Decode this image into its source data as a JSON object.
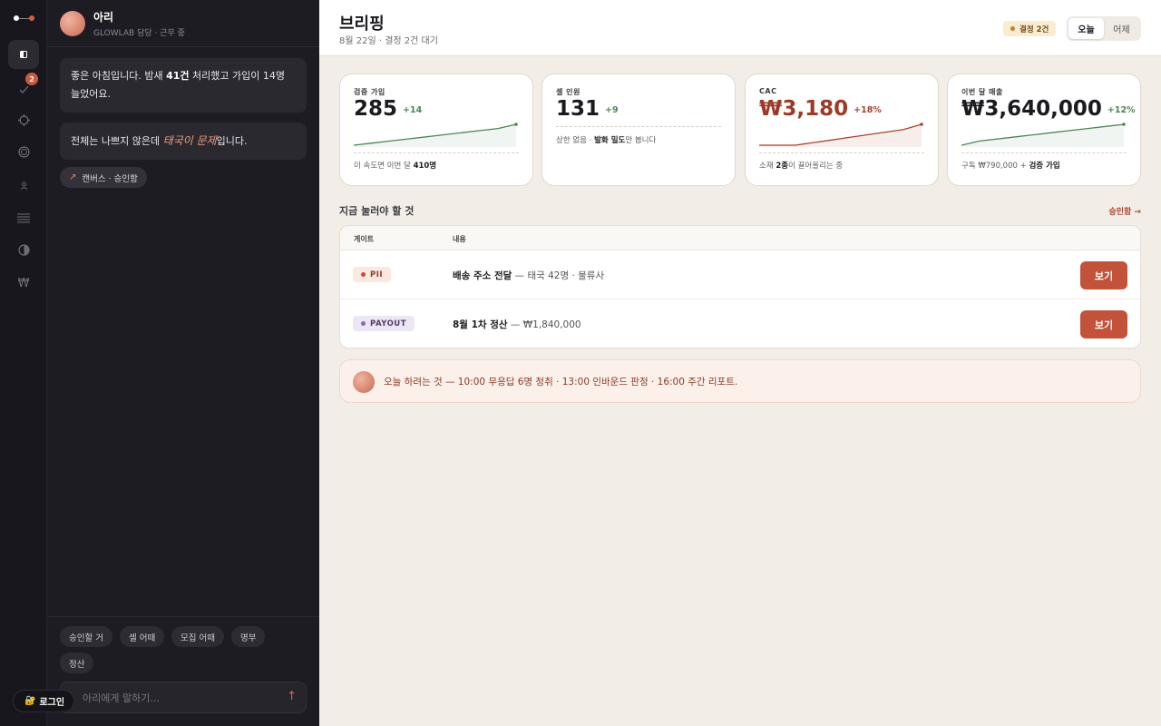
{
  "rail": {
    "notif_badge": "2"
  },
  "chat": {
    "agent_name": "아리",
    "agent_status": "GLOWLAB 담당 · 근무 중",
    "msg1": {
      "p1": "좋은 아침입니다. 밤새 ",
      "bold": "41건",
      "p2": " 처리했고 가입이 14명 늘었어요."
    },
    "msg2": {
      "p1": "전체는 나쁘지 않은데 ",
      "em": "태국이 문제",
      "p2": "입니다."
    },
    "canvas_chip": "캔버스 · 승인함",
    "quick_chips": [
      "승인할 거",
      "셀 어때",
      "모집 어때",
      "명부",
      "정산"
    ],
    "input_placeholder": "아리에게 말하기...",
    "login_label": "로그인"
  },
  "header": {
    "title": "브리핑",
    "subtitle": "8월 22일 · 결정 2건 대기",
    "decision_badge": "결정 2건",
    "tabs": [
      "오늘",
      "어제"
    ],
    "active_tab": "오늘"
  },
  "kpis": [
    {
      "label": "검증 가입",
      "value": "285",
      "delta": "+14",
      "footer_pre": "이 속도면 이번 달 ",
      "footer_bold": "410명",
      "footer_post": "",
      "trend": [
        8,
        9,
        10,
        11,
        12,
        13,
        14,
        15,
        16,
        18
      ]
    },
    {
      "label": "셀 인원",
      "value": "131",
      "delta": "+9",
      "footer_pre": "상한 없음 · ",
      "footer_bold": "발화 밀도",
      "footer_post": "만 봅니다"
    },
    {
      "label": "CAC",
      "value": "₩3,180",
      "delta": "+18%",
      "footer_pre": "소재 ",
      "footer_bold": "2종",
      "footer_post": "이 끌어올리는 중",
      "trend": [
        5,
        5,
        5,
        6,
        7,
        8,
        9,
        10,
        11,
        13
      ]
    },
    {
      "label": "이번 달 매출",
      "value": "₩3,640,000",
      "delta": "+12%",
      "footer_pre": "구독 ₩790,000 + ",
      "footer_bold": "검증 가입",
      "footer_post": "",
      "trend": [
        6,
        8,
        9,
        10,
        11,
        12,
        13,
        14,
        15,
        16
      ]
    }
  ],
  "section": {
    "title": "지금 눌러야 할 것",
    "link": "승인함 →"
  },
  "table": {
    "headers": [
      "게이트",
      "내용"
    ],
    "rows": [
      {
        "gate": "PII",
        "content_bold": "배송 주소 전달",
        "content_rest": " — 태국 42명 · 물류사",
        "action": "보기"
      },
      {
        "gate": "PAYOUT",
        "content_bold": "8월 1차 정산",
        "content_rest": " — ₩1,840,000",
        "action": "보기"
      }
    ]
  },
  "plan": {
    "text": "오늘 하려는 것 — 10:00 무응답 6명 청취 · 13:00 인바운드 판정 · 16:00 주간 리포트."
  },
  "colors": {
    "accent": "#c2523a",
    "positive": "#4c8555",
    "rail_bg": "#18171d",
    "chat_bg": "#1d1c22",
    "main_bg": "#f2ede7"
  }
}
